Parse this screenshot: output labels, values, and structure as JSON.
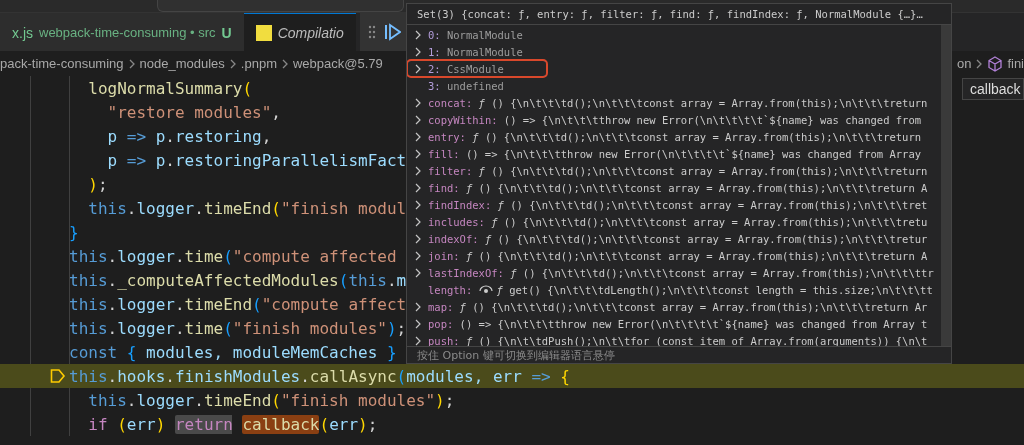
{
  "tabs": [
    {
      "kind": "file",
      "label": "x.js",
      "description": "webpack-time-consuming • src",
      "status": "U",
      "selected": false
    },
    {
      "kind": "preview",
      "label": "Compilatio",
      "selected": true
    }
  ],
  "breadcrumbs": [
    "pack-time-consuming",
    "node_modules",
    ".pnpm",
    "webpack@5.79"
  ],
  "breadcrumbs_right": [
    "on",
    "fini"
  ],
  "suggestion": "callback",
  "code_lines": [
    {
      "current": false,
      "tokens": [
        {
          "text": "  logNormalSummary",
          "kind": "fn"
        },
        {
          "text": "(",
          "kind": "b1"
        }
      ]
    },
    {
      "current": false,
      "tokens": [
        {
          "text": "    \"restore modules\"",
          "kind": "str"
        },
        {
          "text": ",",
          "kind": "p"
        }
      ]
    },
    {
      "current": false,
      "tokens": [
        {
          "text": "    p",
          "kind": "var"
        },
        {
          "text": " => ",
          "kind": "kw"
        },
        {
          "text": "p",
          "kind": "var"
        },
        {
          "text": ".",
          "kind": "p"
        },
        {
          "text": "restoring",
          "kind": "var"
        },
        {
          "text": ",",
          "kind": "p"
        }
      ]
    },
    {
      "current": false,
      "tokens": [
        {
          "text": "    p",
          "kind": "var"
        },
        {
          "text": " => ",
          "kind": "kw"
        },
        {
          "text": "p",
          "kind": "var"
        },
        {
          "text": ".",
          "kind": "p"
        },
        {
          "text": "restoringParallelismFact",
          "kind": "var"
        }
      ]
    },
    {
      "current": false,
      "tokens": [
        {
          "text": "  )",
          "kind": "b1"
        },
        {
          "text": ";",
          "kind": "p"
        }
      ]
    },
    {
      "current": false,
      "tokens": [
        {
          "text": "  this",
          "kind": "kw"
        },
        {
          "text": ".",
          "kind": "p"
        },
        {
          "text": "logger",
          "kind": "var"
        },
        {
          "text": ".",
          "kind": "p"
        },
        {
          "text": "timeEnd",
          "kind": "fn"
        },
        {
          "text": "(",
          "kind": "b1"
        },
        {
          "text": "\"finish modul",
          "kind": "str"
        }
      ]
    },
    {
      "current": false,
      "tokens": [
        {
          "text": "}",
          "kind": "b3"
        }
      ]
    },
    {
      "current": false,
      "tokens": [
        {
          "text": "this",
          "kind": "kw"
        },
        {
          "text": ".",
          "kind": "p"
        },
        {
          "text": "logger",
          "kind": "var"
        },
        {
          "text": ".",
          "kind": "p"
        },
        {
          "text": "time",
          "kind": "fn"
        },
        {
          "text": "(",
          "kind": "b3"
        },
        {
          "text": "\"compute affected",
          "kind": "str"
        }
      ]
    },
    {
      "current": false,
      "tokens": [
        {
          "text": "this",
          "kind": "kw"
        },
        {
          "text": ".",
          "kind": "p"
        },
        {
          "text": "_computeAffectedModules",
          "kind": "fn"
        },
        {
          "text": "(",
          "kind": "b3"
        },
        {
          "text": "this",
          "kind": "kw"
        },
        {
          "text": ".",
          "kind": "p"
        },
        {
          "text": "m",
          "kind": "var"
        }
      ]
    },
    {
      "current": false,
      "tokens": [
        {
          "text": "this",
          "kind": "kw"
        },
        {
          "text": ".",
          "kind": "p"
        },
        {
          "text": "logger",
          "kind": "var"
        },
        {
          "text": ".",
          "kind": "p"
        },
        {
          "text": "timeEnd",
          "kind": "fn"
        },
        {
          "text": "(",
          "kind": "b3"
        },
        {
          "text": "\"compute affect",
          "kind": "str"
        }
      ]
    },
    {
      "current": false,
      "tokens": [
        {
          "text": "this",
          "kind": "kw"
        },
        {
          "text": ".",
          "kind": "p"
        },
        {
          "text": "logger",
          "kind": "var"
        },
        {
          "text": ".",
          "kind": "p"
        },
        {
          "text": "time",
          "kind": "fn"
        },
        {
          "text": "(",
          "kind": "b3"
        },
        {
          "text": "\"finish modules\"",
          "kind": "str"
        },
        {
          "text": ")",
          "kind": "b3"
        },
        {
          "text": ";",
          "kind": "p"
        }
      ]
    },
    {
      "current": false,
      "tokens": [
        {
          "text": "const ",
          "kind": "kw"
        },
        {
          "text": "{",
          "kind": "b3"
        },
        {
          "text": " modules, moduleMemCaches ",
          "kind": "var"
        },
        {
          "text": "}",
          "kind": "b3"
        }
      ]
    },
    {
      "current": true,
      "tokens": [
        {
          "text": "this",
          "kind": "kw"
        },
        {
          "text": ".",
          "kind": "p"
        },
        {
          "text": "hooks",
          "kind": "var"
        },
        {
          "text": ".",
          "kind": "p"
        },
        {
          "text": "finishModules",
          "kind": "var"
        },
        {
          "text": ".",
          "kind": "p"
        },
        {
          "text": "callAsync",
          "kind": "fn"
        },
        {
          "text": "(",
          "kind": "b3"
        },
        {
          "text": "modules, err",
          "kind": "var"
        },
        {
          "text": " => ",
          "kind": "kw"
        },
        {
          "text": "{",
          "kind": "b1"
        }
      ]
    },
    {
      "current": false,
      "tokens": [
        {
          "text": "  this",
          "kind": "kw"
        },
        {
          "text": ".",
          "kind": "p"
        },
        {
          "text": "logger",
          "kind": "var"
        },
        {
          "text": ".",
          "kind": "p"
        },
        {
          "text": "timeEnd",
          "kind": "fn"
        },
        {
          "text": "(",
          "kind": "b1"
        },
        {
          "text": "\"finish modules\"",
          "kind": "str"
        },
        {
          "text": ")",
          "kind": "b1"
        },
        {
          "text": ";",
          "kind": "p"
        }
      ]
    },
    {
      "current": false,
      "tokens": [
        {
          "text": "  if ",
          "kind": "ctrl"
        },
        {
          "text": "(",
          "kind": "b1"
        },
        {
          "text": "err",
          "kind": "var"
        },
        {
          "text": ") ",
          "kind": "b1"
        },
        {
          "text": "return ",
          "kind": "ctrl",
          "word_highlight": true,
          "search_match": false
        },
        {
          "text": "callback",
          "kind": "fn",
          "word_highlight": false,
          "search_match": true
        },
        {
          "text": "(",
          "kind": "b1"
        },
        {
          "text": "err",
          "kind": "var"
        },
        {
          "text": ")",
          "kind": "b1"
        },
        {
          "text": ";",
          "kind": "p"
        }
      ]
    }
  ],
  "hover": {
    "header": "Set(3) {concat: ƒ, entry: ƒ, filter: ƒ, find: ƒ, findIndex: ƒ, NormalModule {…}…",
    "rows": [
      {
        "kind": "index",
        "name": "0:",
        "value": "NormalModule",
        "expandable": true,
        "selected": false,
        "outlined": false
      },
      {
        "kind": "index",
        "name": "1:",
        "value": "NormalModule",
        "expandable": true,
        "selected": false,
        "outlined": false
      },
      {
        "kind": "index",
        "name": "2:",
        "value": "CssModule",
        "expandable": true,
        "selected": true,
        "outlined": true
      },
      {
        "kind": "index",
        "name": "3:",
        "value": "undefined",
        "expandable": false,
        "selected": false,
        "outlined": false
      },
      {
        "kind": "prop",
        "name": "concat:",
        "value": "*ƒ* () {\\n\\t\\t\\td();\\n\\t\\t\\tconst array = Array.from(this);\\n\\t\\t\\treturn",
        "expandable": true,
        "selected": false,
        "outlined": false
      },
      {
        "kind": "prop",
        "name": "copyWithin:",
        "value": "() => {\\n\\t\\t\\tthrow new Error(\\n\\t\\t\\t\\t`${name} was changed from",
        "expandable": true,
        "selected": false,
        "outlined": false
      },
      {
        "kind": "prop",
        "name": "entry:",
        "value": "*ƒ* () {\\n\\t\\t\\td();\\n\\t\\t\\tconst array = Array.from(this);\\n\\t\\t\\treturn",
        "expandable": true,
        "selected": false,
        "outlined": false
      },
      {
        "kind": "prop",
        "name": "fill:",
        "value": "() => {\\n\\t\\t\\tthrow new Error(\\n\\t\\t\\t\\t`${name} was changed from Array",
        "expandable": true,
        "selected": false,
        "outlined": false
      },
      {
        "kind": "prop",
        "name": "filter:",
        "value": "*ƒ* () {\\n\\t\\t\\td();\\n\\t\\t\\tconst array = Array.from(this);\\n\\t\\t\\treturn",
        "expandable": true,
        "selected": false,
        "outlined": false
      },
      {
        "kind": "prop",
        "name": "find:",
        "value": "*ƒ* () {\\n\\t\\t\\td();\\n\\t\\t\\tconst array = Array.from(this);\\n\\t\\t\\treturn A",
        "expandable": true,
        "selected": false,
        "outlined": false
      },
      {
        "kind": "prop",
        "name": "findIndex:",
        "value": "*ƒ* () {\\n\\t\\t\\td();\\n\\t\\t\\tconst array = Array.from(this);\\n\\t\\t\\tret",
        "expandable": true,
        "selected": false,
        "outlined": false
      },
      {
        "kind": "prop",
        "name": "includes:",
        "value": "*ƒ* () {\\n\\t\\t\\td();\\n\\t\\t\\tconst array = Array.from(this);\\n\\t\\t\\tretu",
        "expandable": true,
        "selected": false,
        "outlined": false
      },
      {
        "kind": "prop",
        "name": "indexOf:",
        "value": "*ƒ* () {\\n\\t\\t\\td();\\n\\t\\t\\tconst array = Array.from(this);\\n\\t\\t\\tretur",
        "expandable": true,
        "selected": false,
        "outlined": false
      },
      {
        "kind": "prop",
        "name": "join:",
        "value": "*ƒ* () {\\n\\t\\t\\td();\\n\\t\\t\\tconst array = Array.from(this);\\n\\t\\t\\treturn A",
        "expandable": true,
        "selected": false,
        "outlined": false
      },
      {
        "kind": "prop",
        "name": "lastIndexOf:",
        "value": "*ƒ* () {\\n\\t\\t\\td();\\n\\t\\t\\tconst array = Array.from(this);\\n\\t\\t\\ttr",
        "expandable": true,
        "selected": false,
        "outlined": false
      },
      {
        "kind": "getter",
        "name": "length:",
        "value": "*ƒ* get() {\\n\\t\\t\\tdLength();\\n\\t\\t\\tconst length = this.size;\\n\\t\\t\\tt",
        "expandable": false,
        "selected": false,
        "outlined": false
      },
      {
        "kind": "prop",
        "name": "map:",
        "value": "*ƒ* () {\\n\\t\\t\\td();\\n\\t\\t\\tconst array = Array.from(this);\\n\\t\\t\\treturn Ar",
        "expandable": true,
        "selected": false,
        "outlined": false
      },
      {
        "kind": "prop",
        "name": "pop:",
        "value": "() => {\\n\\t\\t\\tthrow new Error(\\n\\t\\t\\t\\t`${name} was changed from Array t",
        "expandable": true,
        "selected": false,
        "outlined": false
      },
      {
        "kind": "prop",
        "name": "push:",
        "value": "*ƒ* () {\\n\\t\\tdPush();\\n\\t\\tfor (const item of Array.from(arguments)) {\\n\\t",
        "expandable": true,
        "selected": false,
        "outlined": false
      }
    ],
    "footer": "按住 Option 键可切换到编辑器语言悬停"
  }
}
